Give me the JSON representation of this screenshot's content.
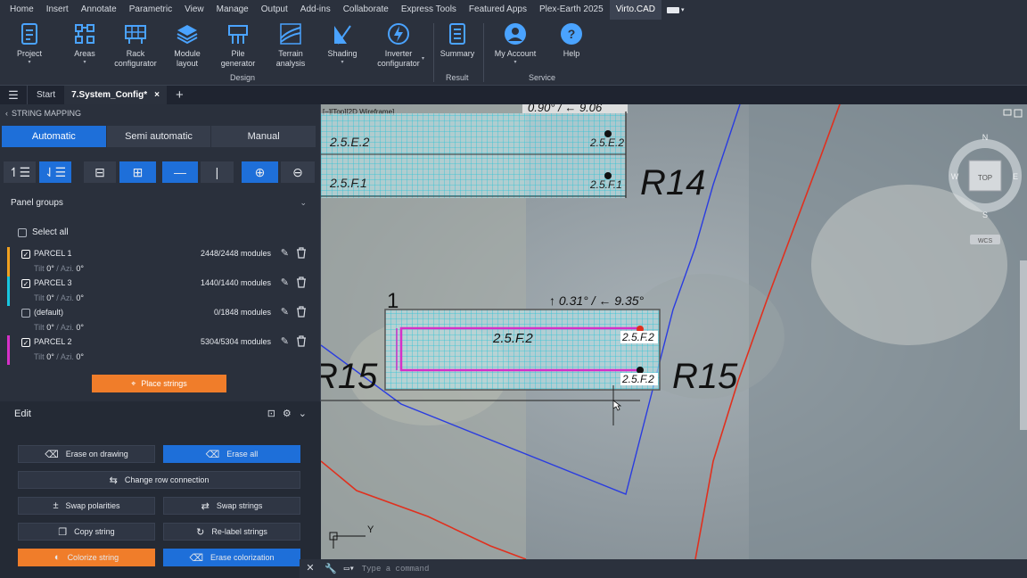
{
  "menu": [
    "Home",
    "Insert",
    "Annotate",
    "Parametric",
    "View",
    "Manage",
    "Output",
    "Add-ins",
    "Collaborate",
    "Express Tools",
    "Featured Apps",
    "Plex-Earth 2025",
    "Virto.CAD"
  ],
  "menu_active_index": 12,
  "ribbon": {
    "project": "Project",
    "areas": "Areas",
    "rack_configurator": [
      "Rack",
      "configurator"
    ],
    "module_layout": [
      "Module",
      "layout"
    ],
    "pile_generator": [
      "Pile",
      "generator"
    ],
    "terrain_analysis": [
      "Terrain",
      "analysis"
    ],
    "shading": "Shading",
    "inverter_configurator": [
      "Inverter",
      "configurator"
    ],
    "summary": "Summary",
    "my_account": "My Account",
    "help": "Help",
    "groups": {
      "design": "Design",
      "result": "Result",
      "service": "Service"
    }
  },
  "tabs": {
    "start": "Start",
    "active": "7.System_Config*",
    "close": "×",
    "add": "+"
  },
  "panel": {
    "title": "STRING MAPPING",
    "modes": [
      "Automatic",
      "Semi automatic",
      "Manual"
    ],
    "active_mode": 0,
    "panel_groups_label": "Panel groups",
    "select_all": "Select all",
    "groups": [
      {
        "name": "PARCEL 1",
        "count": "2448/2448 modules",
        "tilt_label": "Tilt",
        "tilt": "0°",
        "azi_label": "Azi.",
        "azi": "0°",
        "checked": true,
        "color": "#f0a020"
      },
      {
        "name": "PARCEL 3",
        "count": "1440/1440 modules",
        "tilt_label": "Tilt",
        "tilt": "0°",
        "azi_label": "Azi.",
        "azi": "0°",
        "checked": true,
        "color": "#18c6e0"
      },
      {
        "name": "(default)",
        "count": "0/1848 modules",
        "tilt_label": "Tilt",
        "tilt": "0°",
        "azi_label": "Azi.",
        "azi": "0°",
        "checked": false,
        "color": ""
      },
      {
        "name": "PARCEL 2",
        "count": "5304/5304 modules",
        "tilt_label": "Tilt",
        "tilt": "0°",
        "azi_label": "Azi.",
        "azi": "0°",
        "checked": true,
        "color": "#d630c8"
      }
    ],
    "place_strings": "Place strings",
    "edit_label": "Edit",
    "edit_buttons": {
      "erase_on_drawing": "Erase on drawing",
      "erase_all": "Erase all",
      "change_row_connection": "Change row connection",
      "swap_polarities": "Swap polarities",
      "swap_strings": "Swap strings",
      "copy_string": "Copy string",
      "relabel_strings": "Re-label strings",
      "colorize_string": "Colorize string",
      "erase_colorization": "Erase colorization"
    }
  },
  "viewport": {
    "label": "[−][Top][2D Wireframe]",
    "top_angle": "0.90° / ← 9.06",
    "angle": "↑ 0.31° / ← 9.35°",
    "row_number": "1",
    "labels": {
      "r14": "R14",
      "r15_left": "R15",
      "r15_right": "R15"
    },
    "blocks": {
      "e2": "2.5.E.2",
      "f1": "2.5.F.1",
      "e2_right": "2.5.E.2",
      "f1_right": "2.5.F.1",
      "f2_center": "2.5.F.2",
      "f2_tag_top": "2.5.F.2",
      "f2_tag_bottom": "2.5.F.2"
    },
    "compass": {
      "n": "N",
      "w": "W",
      "e": "E",
      "s": "S",
      "top": "TOP",
      "wcs": "WCS"
    },
    "ucs_y": "Y"
  },
  "command_placeholder": "Type a command",
  "colors": {
    "accent": "#1e6fd9",
    "orange": "#f07d2a",
    "cyan": "#18c6e0",
    "magenta": "#d630c8",
    "red_line": "#e0301e",
    "blue_line": "#2a3ce0"
  }
}
